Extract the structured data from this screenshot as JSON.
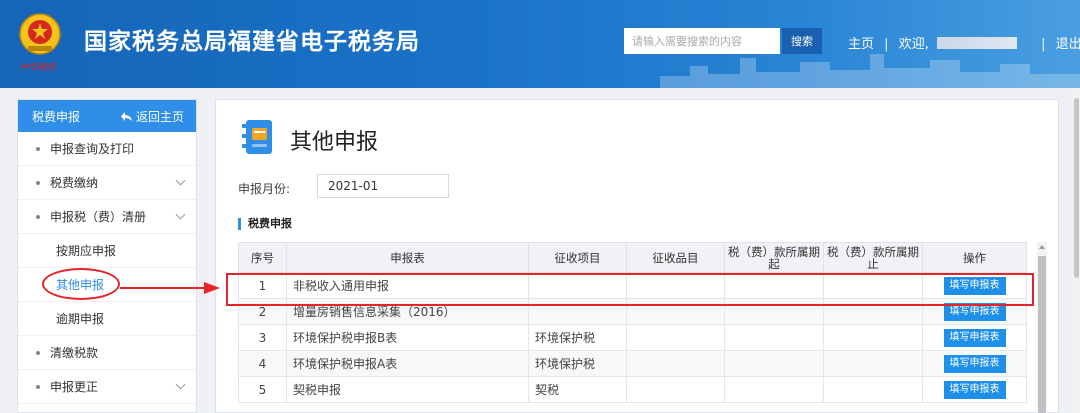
{
  "header": {
    "site_title": "国家税务总局福建省电子税务局",
    "emblem_sign": "中华税务",
    "search_placeholder": "请输入需要搜索的内容",
    "search_button": "搜索",
    "home_link": "主页",
    "welcome": "欢迎,",
    "logout": "退出"
  },
  "sidebar": {
    "title": "税费申报",
    "back_label": "返回主页",
    "items": [
      {
        "label": "申报查询及打印"
      },
      {
        "label": "税费缴纳"
      },
      {
        "label": "申报税（费）清册"
      },
      {
        "label": "按期应申报"
      },
      {
        "label": "其他申报"
      },
      {
        "label": "逾期申报"
      },
      {
        "label": "清缴税款"
      },
      {
        "label": "申报更正"
      }
    ]
  },
  "main": {
    "page_title": "其他申报",
    "month_label": "申报月份:",
    "month_value": "2021-01",
    "section_title": "税费申报",
    "table": {
      "headers": [
        "序号",
        "申报表",
        "征收项目",
        "征收品目",
        "税（费）款所属期起",
        "税（费）款所属期止",
        "操作"
      ],
      "rows": [
        {
          "no": "1",
          "form": "非税收入通用申报",
          "item": "",
          "sub": "",
          "start": "",
          "end": "",
          "action": "填写申报表"
        },
        {
          "no": "2",
          "form": "增量房销售信息采集（2016）",
          "item": "",
          "sub": "",
          "start": "",
          "end": "",
          "action": "填写申报表"
        },
        {
          "no": "3",
          "form": "环境保护税申报B表",
          "item": "环境保护税",
          "sub": "",
          "start": "",
          "end": "",
          "action": "填写申报表"
        },
        {
          "no": "4",
          "form": "环境保护税申报A表",
          "item": "环境保护税",
          "sub": "",
          "start": "",
          "end": "",
          "action": "填写申报表"
        },
        {
          "no": "5",
          "form": "契税申报",
          "item": "契税",
          "sub": "",
          "start": "",
          "end": "",
          "action": "填写申报表"
        }
      ]
    }
  },
  "colors": {
    "header_blue": "#1a73c8",
    "accent_blue": "#2f8ee8",
    "annotation_red": "#e5252a"
  }
}
